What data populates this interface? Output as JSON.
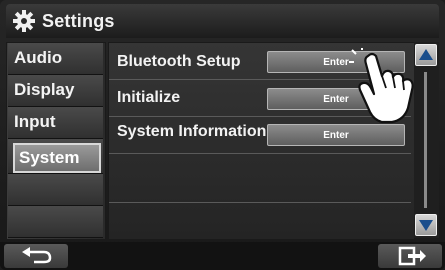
{
  "header": {
    "title": "Settings",
    "icon": "gear-icon"
  },
  "sidebar": {
    "items": [
      {
        "label": "Audio"
      },
      {
        "label": "Display"
      },
      {
        "label": "Input"
      },
      {
        "label": "System",
        "selected": true
      }
    ]
  },
  "main": {
    "rows": [
      {
        "label": "Bluetooth Setup",
        "button": "Enter"
      },
      {
        "label": "Initialize",
        "button": "Enter"
      },
      {
        "label": "System Information",
        "button": "Enter"
      }
    ]
  },
  "scrollbar": {
    "up_icon": "arrow-up-icon",
    "down_icon": "arrow-down-icon"
  },
  "footer": {
    "back_icon": "back-arrow-icon",
    "exit_icon": "exit-icon"
  },
  "colors": {
    "accent": "#d8d8d8",
    "background": "#1d1d1d",
    "button": "#7a7a7a"
  }
}
